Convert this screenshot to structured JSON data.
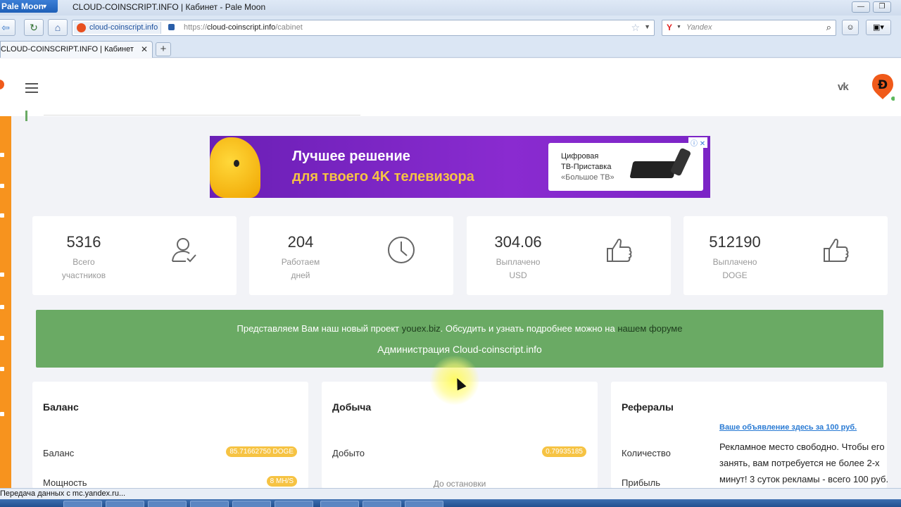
{
  "browser": {
    "app_menu_label": "Pale Moon",
    "window_title": "CLOUD-COINSCRIPT.INFO | Кабинет - Pale Moon",
    "identity_label": "cloud-coinscript.info",
    "url_prefix": "https://",
    "url_host": "cloud-coinscript.info",
    "url_path": "/cabinet",
    "search_placeholder": "Yandex",
    "search_engine_letter": "Y",
    "tab_title": "CLOUD-COINSCRIPT.INFO | Кабинет",
    "status_text": "Передача данных с mc.yandex.ru..."
  },
  "banner": {
    "headline": "Лучшее решение",
    "subline": "для твоего 4K телевизора",
    "box_line1": "Цифровая",
    "box_line2": "ТВ-Приставка",
    "box_line3": "«Большое ТВ»",
    "ad_marks": "ⓘ ✕"
  },
  "stats": [
    {
      "value": "5316",
      "label_line1": "Всего",
      "label_line2": "участников",
      "icon": "user-check-icon"
    },
    {
      "value": "204",
      "label_line1": "Работаем",
      "label_line2": "дней",
      "icon": "clock-icon"
    },
    {
      "value": "304.06",
      "label_line1": "Выплачено",
      "label_line2": "USD",
      "icon": "thumbs-up-icon"
    },
    {
      "value": "512190",
      "label_line1": "Выплачено",
      "label_line2": "DOGE",
      "icon": "thumbs-up-icon"
    }
  ],
  "notice": {
    "text_before": "Представляем Вам наш новый проект ",
    "project_link": "youex.biz",
    "text_middle": ". Обсудить и узнать подробнее можно на ",
    "forum_link": "нашем форуме",
    "signature": "Администрация Cloud-coinscript.info"
  },
  "panels": {
    "balance": {
      "title": "Баланс",
      "row1_label": "Баланс",
      "row1_badge": "85.71662750 DOGE",
      "row2_label": "Мощность",
      "row2_badge": "8 MH/S"
    },
    "mining": {
      "title": "Добыча",
      "row1_label": "Добыто",
      "row1_badge": "0.79935185",
      "row2_label": "До остановки"
    },
    "referrals": {
      "title": "Рефералы",
      "row1_label": "Количество",
      "row2_label": "Прибыль"
    }
  },
  "ad_block": {
    "link": "Ваше объявление здесь за 100 руб.",
    "text": "Рекламное место свободно. Чтобы его занять, вам потребуется не более 2-х минут! 3 суток рекламы - всего 100 руб."
  },
  "colors": {
    "accent_orange": "#f7931e",
    "notice_green": "#6aaa64",
    "badge_yellow": "#f6c343",
    "banner_purple": "#7b24c6"
  }
}
